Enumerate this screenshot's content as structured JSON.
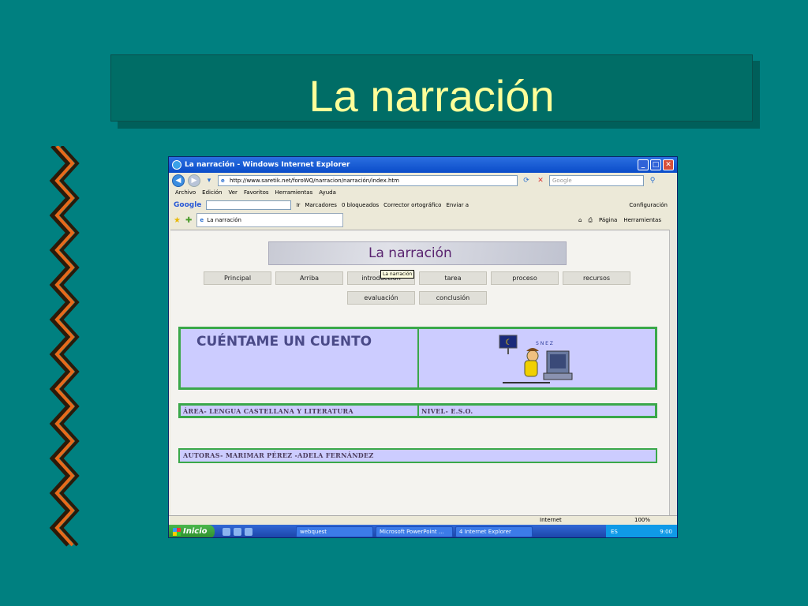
{
  "slide": {
    "title": "La narración"
  },
  "browser": {
    "window_title": "La narración - Windows Internet Explorer",
    "url": "http://www.saretik.net/foroWQ/narracion/narración/index.htm",
    "search_placeholder": "Google",
    "menu": [
      "Archivo",
      "Edición",
      "Ver",
      "Favoritos",
      "Herramientas",
      "Ayuda"
    ],
    "google_bar": {
      "go": "Ir",
      "bookmarks": "Marcadores",
      "blocked": "0 bloqueados",
      "spell": "Corrector ortográfico",
      "send": "Enviar a",
      "settings": "Configuración"
    },
    "tab_label": "La narración",
    "tab_tools": {
      "page": "Página",
      "tools": "Herramientas"
    },
    "status": {
      "zone": "Internet",
      "zoom": "100%"
    }
  },
  "page": {
    "banner_title": "La narración",
    "nav_row1": [
      "Principal",
      "Arriba",
      "introducción",
      "tarea",
      "proceso",
      "recursos"
    ],
    "nav_row2": [
      "evaluación",
      "conclusión"
    ],
    "tooltip": "La narración",
    "heading": "CUÉNTAME UN CUENTO",
    "area": "ÁREA- LENGUA CASTELLANA Y LITERATURA",
    "nivel": "NIVEL- E.S.O.",
    "autoras": "AUTORAS- MARIMAR PÉREZ -ADELA FERNÁNDEZ"
  },
  "taskbar": {
    "start": "Inicio",
    "tasks": [
      "webquest",
      "Microsoft PowerPoint ...",
      "4 Internet Explorer"
    ],
    "lang": "ES",
    "clock": "9:00"
  }
}
